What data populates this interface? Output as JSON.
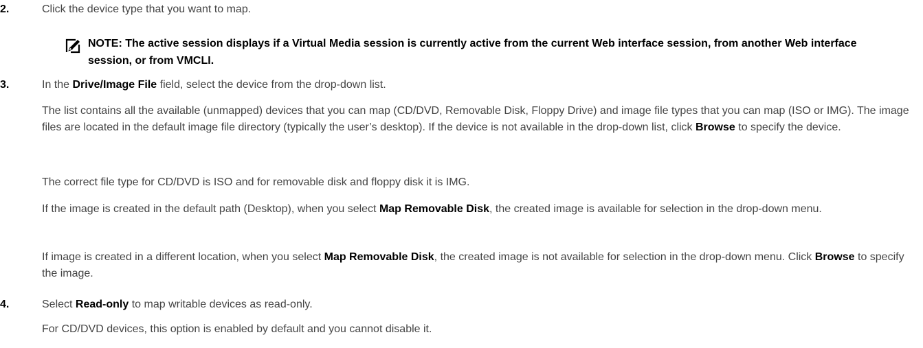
{
  "steps": [
    {
      "number": "2.",
      "text": "Click the device type that you want to map."
    },
    {
      "note": "NOTE: The active session displays if a Virtual Media session is currently active from the current Web interface session, from another Web interface session, or from VMCLI."
    },
    {
      "number": "3.",
      "intro_prefix": "In the ",
      "intro_bold": "Drive/Image File",
      "intro_suffix": " field, select the device from the drop-down list.",
      "p1_text": "The list contains all the available (unmapped) devices that you can map (CD/DVD, Removable Disk, Floppy Drive) and image file types that you can map (ISO or IMG). The image files are located in the default image file directory (typically the user’s desktop). If the device is not available in the drop-down list, click ",
      "p1_bold": "Browse",
      "p1_suffix": " to specify the device.",
      "p2": "The correct file type for CD/DVD is ISO and for removable disk and floppy disk it is IMG.",
      "p3_prefix": "If the image is created in the default path (Desktop), when you select ",
      "p3_bold": "Map Removable Disk",
      "p3_suffix": ", the created image is available for selection in the drop-down menu.",
      "p4_prefix": "If image is created in a different location, when you select ",
      "p4_bold": "Map Removable Disk",
      "p4_mid": ", the created image is not available for selection in the drop-down menu. Click ",
      "p4_bold2": "Browse",
      "p4_suffix": " to specify the image."
    },
    {
      "number": "4.",
      "intro_prefix": "Select ",
      "intro_bold": "Read-only",
      "intro_suffix": " to map writable devices as read-only.",
      "p1": "For CD/DVD devices, this option is enabled by default and you cannot disable it."
    }
  ],
  "icons": {
    "note": "note-pencil-icon"
  },
  "colors": {
    "text": "#444444",
    "bold": "#000000"
  }
}
